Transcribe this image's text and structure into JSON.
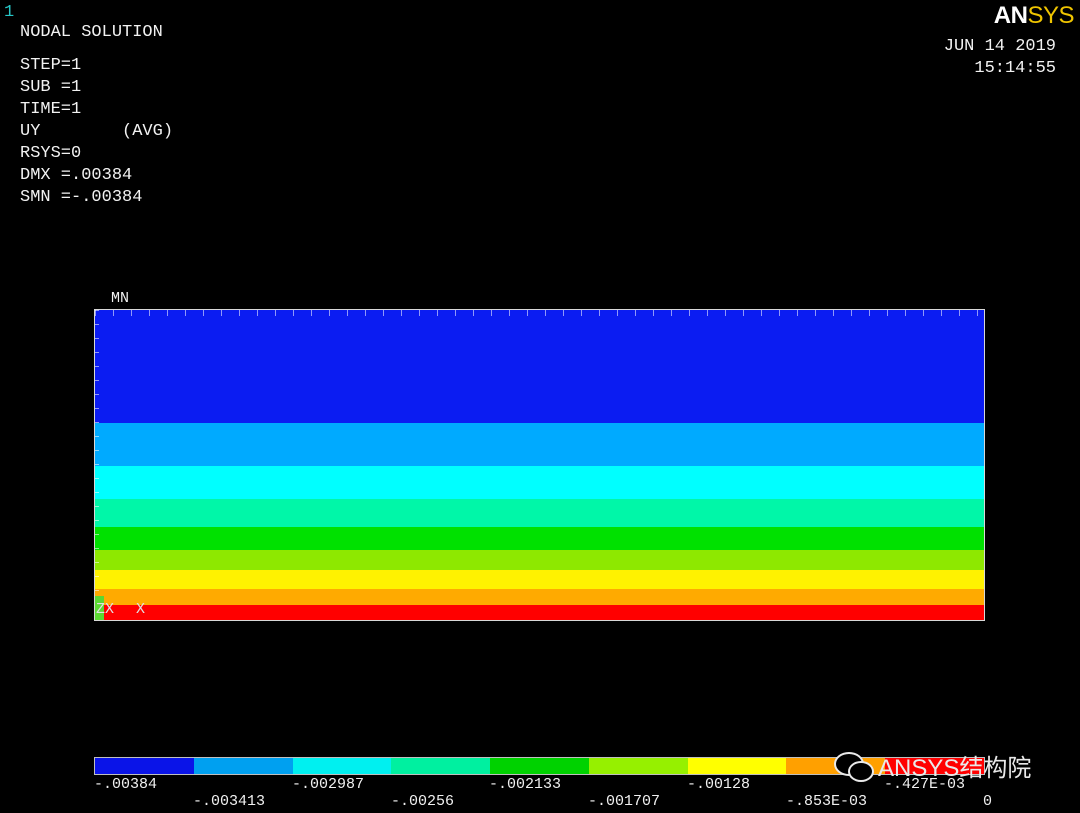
{
  "window_number": "1",
  "logo": {
    "part1": "AN",
    "part2": "SYS"
  },
  "header": {
    "title": "NODAL SOLUTION",
    "lines": [
      "STEP=1",
      "SUB =1",
      "TIME=1",
      "UY        (AVG)",
      "RSYS=0",
      "DMX =.00384",
      "SMN =-.00384"
    ]
  },
  "timestamp": {
    "date": "JUN 14 2019",
    "time": "15:14:55"
  },
  "plot": {
    "mn_label": "MN",
    "axis_label": "X",
    "origin_label": "ZX",
    "band_colors": [
      "#0b1cf2",
      "#00aaff",
      "#00ffff",
      "#00f7a8",
      "#00e100",
      "#8ee800",
      "#fff200",
      "#ffaa00",
      "#ff0000"
    ],
    "band_fractions": [
      0.365,
      0.14,
      0.105,
      0.09,
      0.075,
      0.065,
      0.06,
      0.05,
      0.05
    ]
  },
  "legend": {
    "colors": [
      "#0a14e8",
      "#00a0f0",
      "#00f0f0",
      "#00f0a0",
      "#00d200",
      "#96f000",
      "#ffff00",
      "#ffa000",
      "#ff0000"
    ],
    "top_labels": [
      "-.00384",
      "-.002987",
      "-.002133",
      "-.00128",
      "-.427E-03"
    ],
    "bottom_labels": [
      "-.003413",
      "-.00256",
      "-.001707",
      "-.853E-03",
      "0"
    ]
  },
  "watermark": {
    "text": "ANSYS结构院"
  }
}
